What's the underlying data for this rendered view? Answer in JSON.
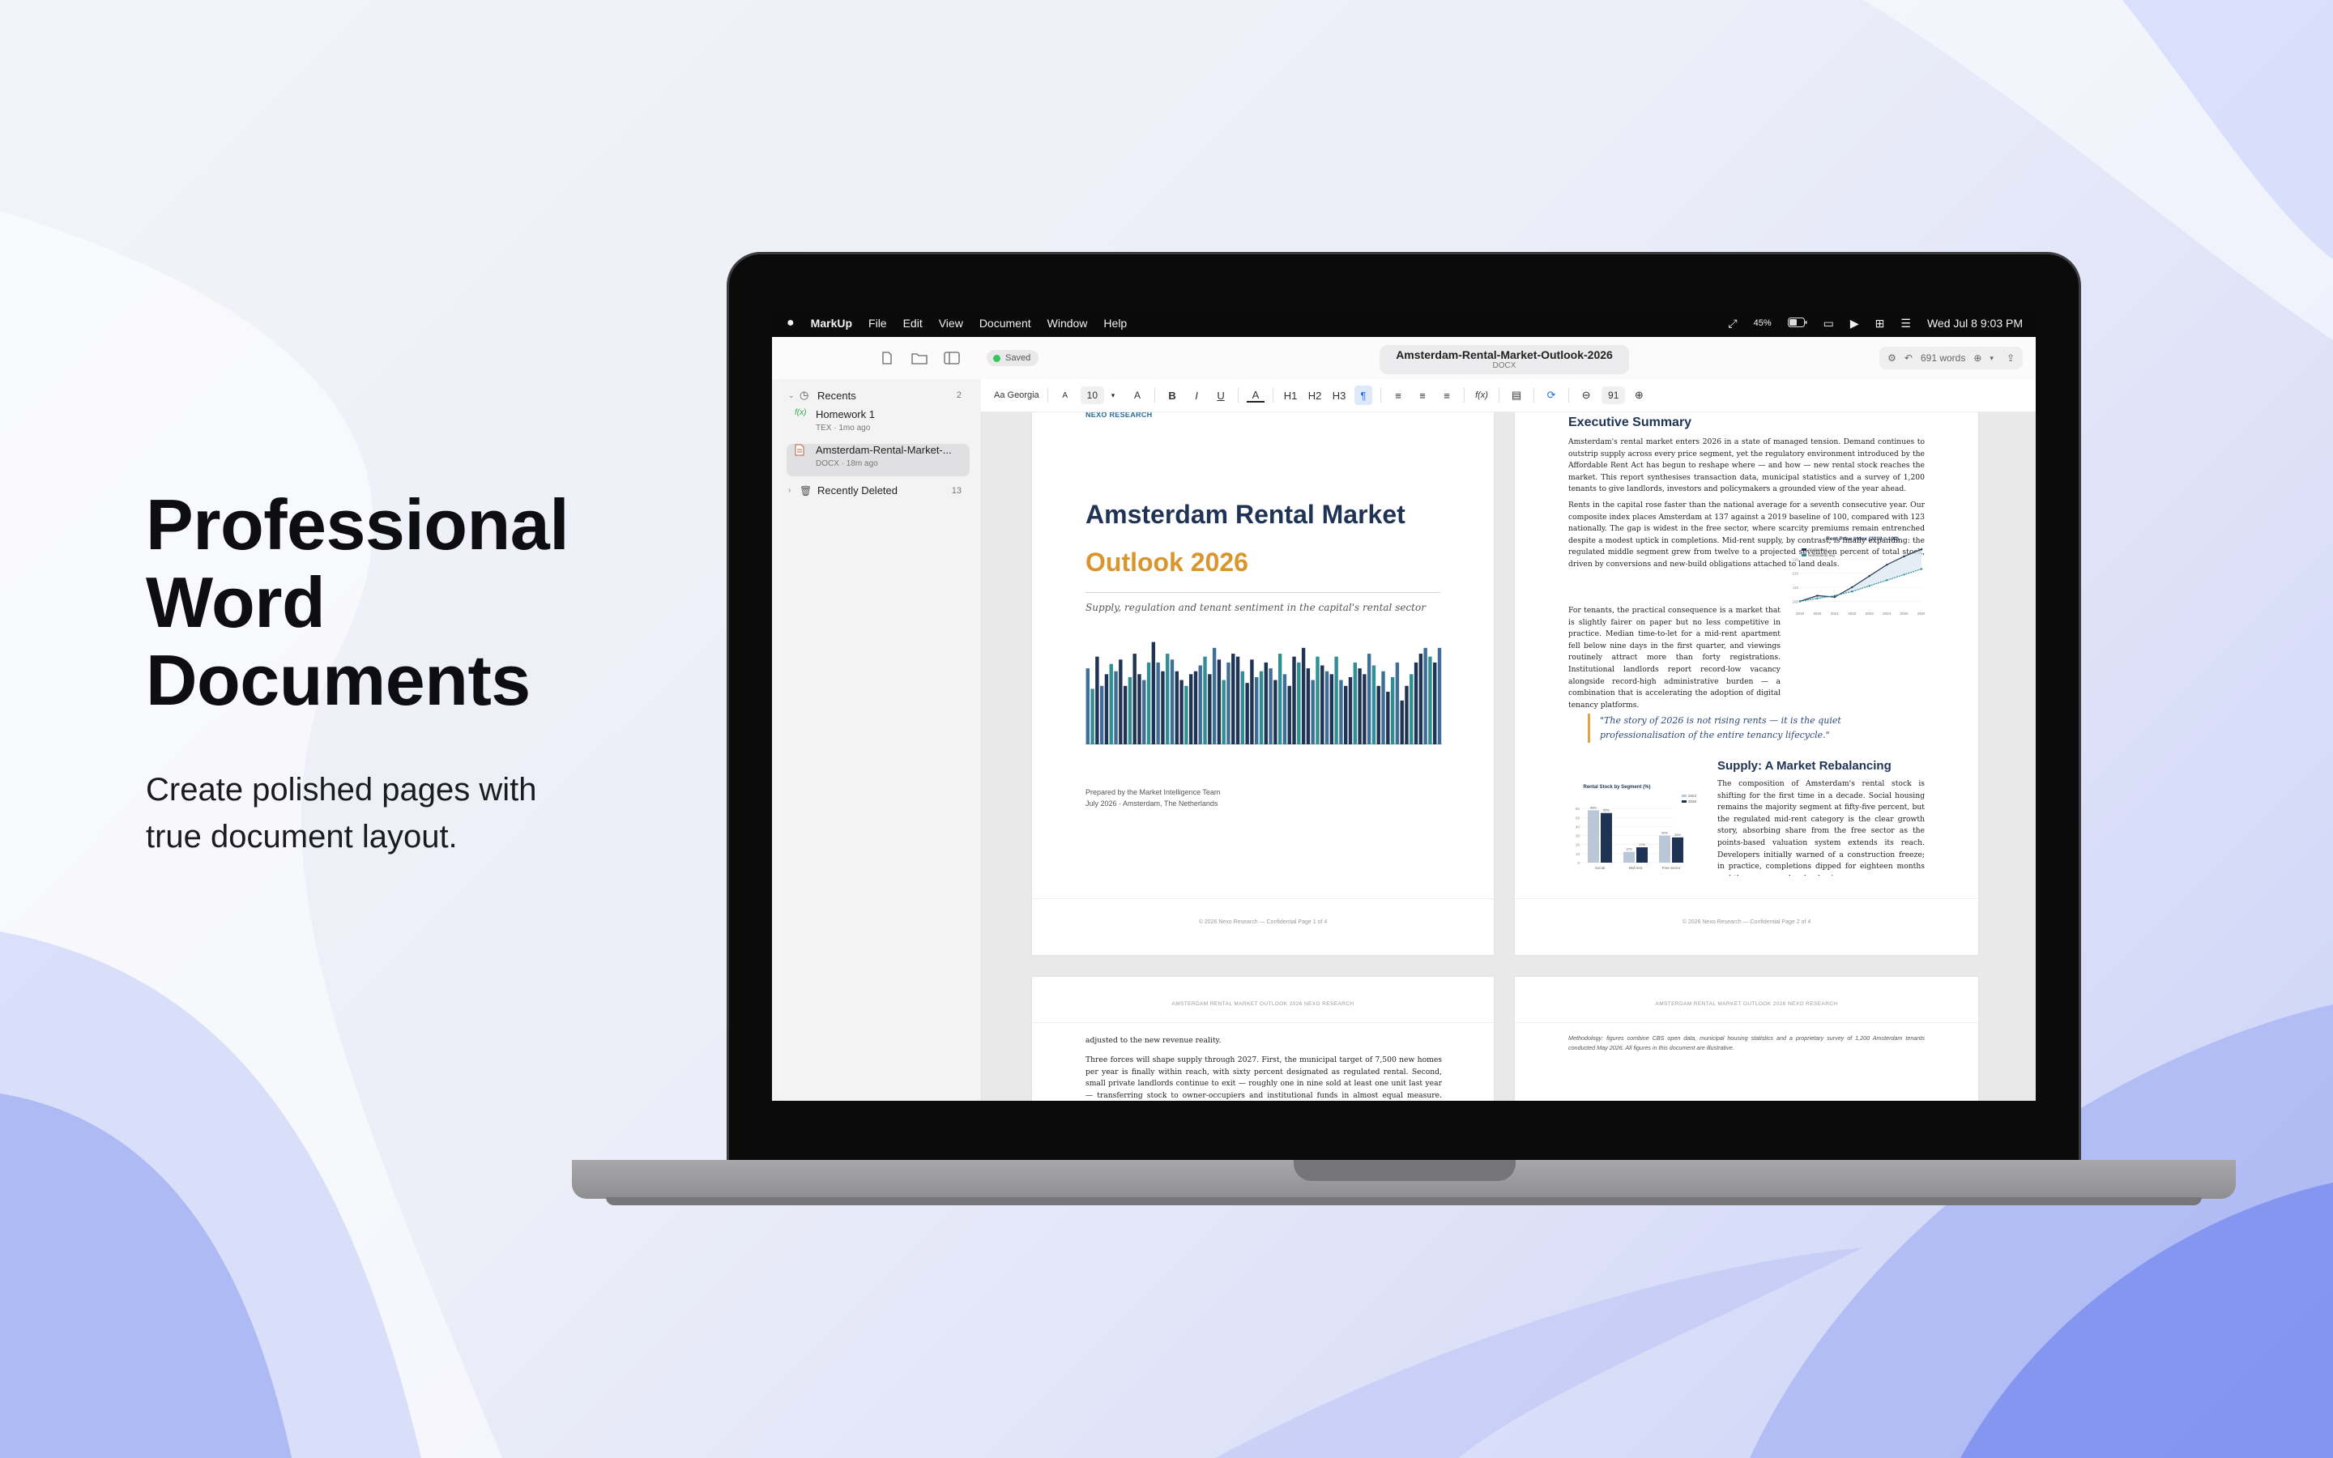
{
  "hero": {
    "title_lines": [
      "Professional",
      "Word",
      "Documents"
    ],
    "subtitle_lines": [
      "Create polished pages with",
      "true document layout."
    ]
  },
  "menubar": {
    "app": "MarkUp",
    "items": [
      "File",
      "Edit",
      "View",
      "Document",
      "Window",
      "Help"
    ],
    "battery": "45%",
    "datetime": "Wed Jul 8  9:03 PM"
  },
  "toolbar": {
    "saved": "Saved",
    "doc_title": "Amsterdam-Rental-Market-Outlook-2026",
    "doc_type": "DOCX",
    "word_count": "691 words"
  },
  "sidebar": {
    "recents_label": "Recents",
    "recents_count": "2",
    "items": [
      {
        "name": "Homework 1",
        "meta": "TEX · 1mo ago",
        "icon": "f(x)"
      },
      {
        "name": "Amsterdam-Rental-Market-...",
        "meta": "DOCX · 18m ago",
        "icon": "doc"
      }
    ],
    "deleted_label": "Recently Deleted",
    "deleted_count": "13"
  },
  "format": {
    "font": "Aa Georgia",
    "size": "10",
    "zoom": "91",
    "small_a": "A",
    "big_a": "A",
    "bold": "B",
    "italic": "I",
    "underline": "U",
    "color_a": "A",
    "h1": "H1",
    "h2": "H2",
    "h3": "H3",
    "pilcrow": "¶",
    "fx": "f(x)"
  },
  "page1": {
    "brand": "NEXO RESEARCH",
    "title": "Amsterdam Rental Market",
    "subtitle": "Outlook 2026",
    "tagline": "Supply, regulation and tenant sentiment in the capital's rental sector",
    "prepared": "Prepared by the Market Intelligence Team",
    "date_place": "July 2026  ·  Amsterdam, The Netherlands",
    "footer": "© 2026 Nexo Research — Confidential    Page 1 of 4"
  },
  "page2": {
    "heading1": "Executive Summary",
    "para1": "Amsterdam's rental market enters 2026 in a state of managed tension. Demand continues to outstrip supply across every price segment, yet the regulatory environment introduced by the Affordable Rent Act has begun to reshape where — and how — new rental stock reaches the market. This report synthesises transaction data, municipal statistics and a survey of 1,200 tenants to give landlords, investors and policymakers a grounded view of the year ahead.",
    "para2a": "Rents in the capital rose faster than the national average for a seventh consecutive year. Our composite index places Amsterdam at 137 against a 2019 baseline of 100, compared with 123 nationally. The gap is widest in the free sector, where scarcity premiums remain entrenched despite a modest uptick in completions. Mid-rent supply, by contrast, is finally expanding: the regulated middle segment grew from twelve to a projected seventeen percent of total stock, driven by conversions and new-build obligations attached to land deals.",
    "para3a": "For tenants, the practical consequence is a market that is slightly fairer on paper but no less competitive in practice. Median time-to-let for a mid-rent apartment fell below nine days in the first quarter, and viewings routinely attract more than forty registrations. Institutional landlords report record-low vacancy alongside record-high administrative burden — a combination that is accelerating the adoption of digital tenancy platforms.",
    "quote": "\"The story of 2026 is not rising rents — it is the quiet professionalisation of the entire tenancy lifecycle.\"",
    "heading2": "Supply: A Market Rebalancing",
    "para4": "The composition of Amsterdam's rental stock is shifting for the first time in a decade. Social housing remains the majority segment at fifty-five percent, but the regulated mid-rent category is the clear growth story, absorbing share from the free sector as the points-based valuation system extends its reach. Developers initially warned of a construction freeze; in practice, completions dipped for eighteen months and then recovered as land prices",
    "footer": "© 2026 Nexo Research — Confidential    Page 2 of 4",
    "line_chart_title": "Rent Price Index (2019 = 100)",
    "line_legend": [
      "Amsterdam",
      "Netherlands avg"
    ],
    "bar_chart_title": "Rental Stock by Segment (%)",
    "bar_legend": [
      "2023",
      "2026"
    ]
  },
  "page3": {
    "running": "AMSTERDAM RENTAL MARKET OUTLOOK 2026 NEXO RESEARCH",
    "para1": "adjusted to the new revenue reality.",
    "para2": "Three forces will shape supply through 2027. First, the municipal target of 7,500 new homes per year is finally within reach, with sixty percent designated as regulated rental. Second, small private landlords continue to exit — roughly one in nine sold at least one unit last year — transferring stock to owner-occupiers and institutional funds in almost equal measure. Third, the short-stay segment"
  },
  "page4": {
    "running": "AMSTERDAM RENTAL MARKET OUTLOOK 2026 NEXO RESEARCH",
    "note": "Methodology: figures combine CBS open data, municipal housing statistics and a proprietary survey of 1,200 Amsterdam tenants conducted May 2026. All figures in this document are illustrative."
  },
  "chart_data": [
    {
      "type": "bar",
      "title": "",
      "values": [
        52,
        38,
        60,
        40,
        48,
        55,
        50,
        58,
        40,
        46,
        62,
        48,
        44,
        56,
        70,
        56,
        50,
        62,
        58,
        50,
        44,
        40,
        48,
        50,
        54,
        60,
        48,
        66,
        58,
        44,
        56,
        62,
        60,
        50,
        42,
        58,
        46,
        50,
        56,
        52,
        44,
        62,
        48,
        40,
        60,
        56,
        66,
        52,
        44,
        60,
        54,
        50,
        48,
        60,
        44,
        40,
        46,
        56,
        52,
        48,
        62,
        54,
        40,
        50,
        36,
        46,
        56,
        30,
        40,
        48,
        56,
        62,
        66,
        60,
        56,
        66
      ]
    },
    {
      "type": "line",
      "title": "Rent Price Index (2019 = 100)",
      "categories": [
        "2019",
        "2020",
        "2021",
        "2022",
        "2023",
        "2024",
        "2025",
        "2026"
      ],
      "series": [
        {
          "name": "Amsterdam",
          "values": [
            100,
            104,
            103,
            110,
            118,
            126,
            132,
            137
          ]
        },
        {
          "name": "Netherlands avg",
          "values": [
            100,
            102,
            104,
            107,
            111,
            115,
            119,
            123
          ]
        }
      ],
      "ylim": [
        95,
        140
      ]
    },
    {
      "type": "bar",
      "title": "Rental Stock by Segment (%)",
      "categories": [
        "Social",
        "Mid-rent",
        "Free sector"
      ],
      "series": [
        {
          "name": "2023",
          "values": [
            58,
            12,
            30
          ]
        },
        {
          "name": "2026",
          "values": [
            55,
            17,
            28
          ]
        }
      ],
      "ylim": [
        0,
        70
      ]
    }
  ]
}
